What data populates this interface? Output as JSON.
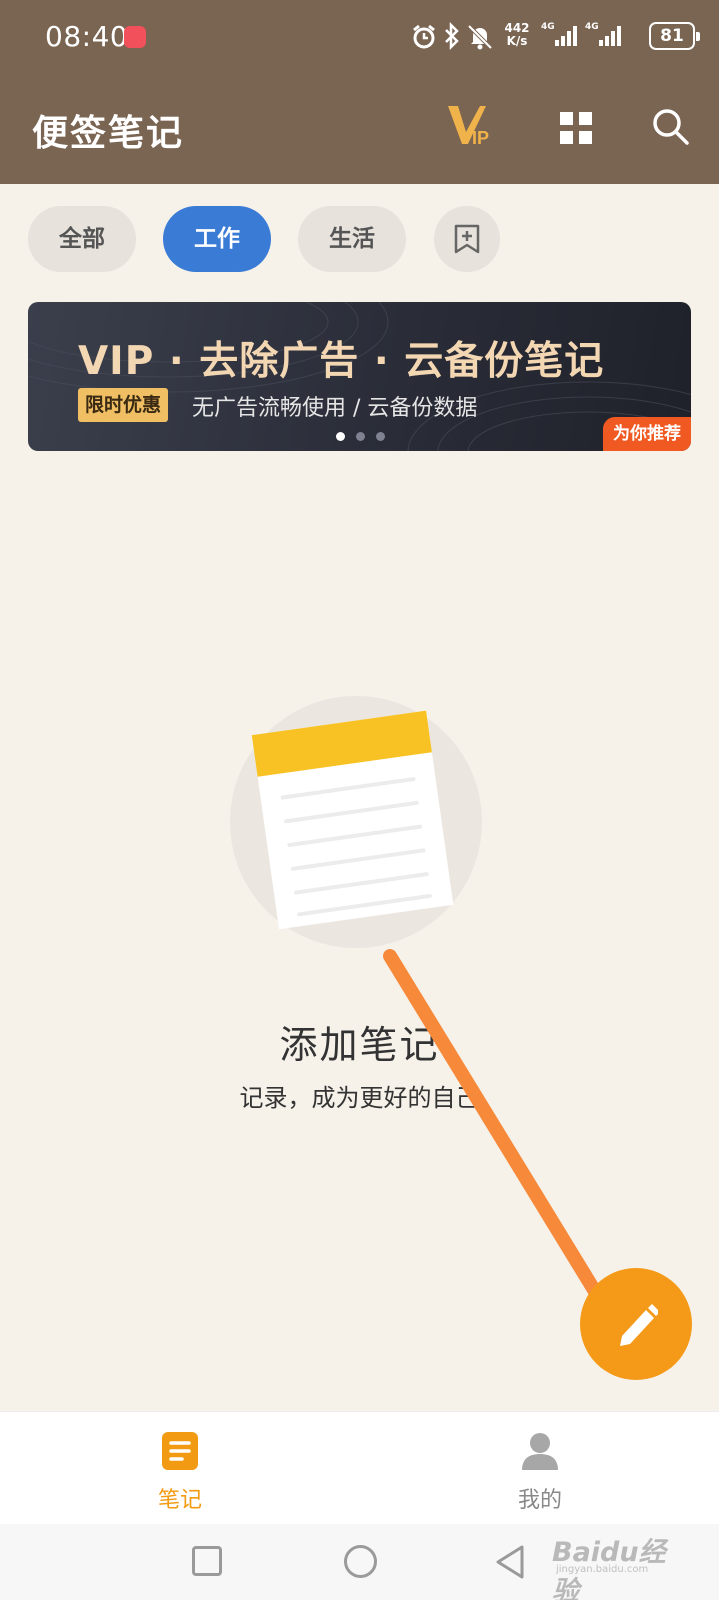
{
  "status_bar": {
    "time": "08:40",
    "net_speed_value": "442",
    "net_speed_unit": "K/s",
    "network_type_1": "4G",
    "network_type_2": "4G",
    "battery": "81",
    "icons": [
      "alarm-icon",
      "bluetooth-icon",
      "mute-icon",
      "signal-icon",
      "signal-icon"
    ]
  },
  "header": {
    "title": "便签笔记",
    "vip_icon": "vip-icon",
    "grid_icon": "grid-icon",
    "search_icon": "search-icon",
    "background_color": "#7a6452"
  },
  "categories": {
    "items": [
      {
        "label": "全部",
        "active": false
      },
      {
        "label": "工作",
        "active": true
      },
      {
        "label": "生活",
        "active": false
      }
    ],
    "add_icon": "bookmark-add-icon",
    "active_color": "#3a7bd5"
  },
  "banner": {
    "title": "VIP · 去除广告 · 云备份笔记",
    "badge": "限时优惠",
    "subtitle": "无广告流畅使用 / 云备份数据",
    "tag": "为你推荐",
    "dot_count": 3,
    "active_dot": 0
  },
  "empty_state": {
    "illustration": "notepad-icon",
    "title": "添加笔记",
    "subtitle": "记录，成为更好的自己"
  },
  "fab": {
    "icon": "pencil-icon",
    "color": "#f59a18"
  },
  "bottom_nav": {
    "items": [
      {
        "label": "笔记",
        "icon": "notes-icon",
        "active": true
      },
      {
        "label": "我的",
        "icon": "person-icon",
        "active": false
      }
    ],
    "active_color": "#f19a12"
  },
  "system_nav": {
    "icons": [
      "recent-apps-icon",
      "home-icon",
      "back-icon"
    ]
  },
  "watermark": {
    "text": "Baidu经验",
    "sub": "jingyan.baidu.com"
  }
}
